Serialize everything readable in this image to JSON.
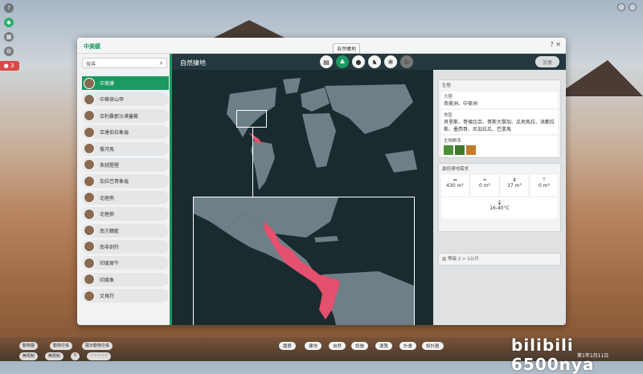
{
  "app": {
    "window_title": "中美貘",
    "tooltip": "自然棲地"
  },
  "left_bar": {
    "help": "?",
    "badge_count": "3"
  },
  "search": {
    "placeholder": "搜尋"
  },
  "animals": [
    {
      "name": "中美貘",
      "selected": true
    },
    {
      "name": "中華穿山甲"
    },
    {
      "name": "亞利桑那沙漠蓋蠍"
    },
    {
      "name": "亞達伯拉象龜"
    },
    {
      "name": "倭河馬"
    },
    {
      "name": "侏狨猩猩"
    },
    {
      "name": "加拉巴哥象龜"
    },
    {
      "name": "北極熊"
    },
    {
      "name": "北極狼"
    },
    {
      "name": "南方鶴鴕"
    },
    {
      "name": "南非劍羚"
    },
    {
      "name": "印度犀牛"
    },
    {
      "name": "印度象"
    },
    {
      "name": "叉角羚"
    }
  ],
  "main": {
    "title": "自然棲地",
    "tabs": [
      {
        "icon": "notebook-icon"
      },
      {
        "icon": "habitat-icon",
        "active": true
      },
      {
        "icon": "food-icon"
      },
      {
        "icon": "social-icon"
      },
      {
        "icon": "paw-icon"
      },
      {
        "icon": "trophy-icon"
      }
    ]
  },
  "right": {
    "header_button": "放養",
    "ecology": {
      "title": "生態",
      "continent_label": "大陸",
      "continent_value": "南美洲、中美洲",
      "region_label": "地區",
      "region_value": "貝里斯、哥倫比亞、哥斯大黎加、瓜地馬拉、洪都拉斯、墨西哥、尼加拉瓜、巴拿馬",
      "biome_label": "生物群系"
    },
    "habitat": {
      "title": "最低棲地需求",
      "stats": [
        "430 m²",
        "0 m²",
        "37 m³",
        "0 m²"
      ],
      "temperature": "16-40°C",
      "footer": "等級 2 > 1公尺"
    }
  },
  "bottom": {
    "left_buttons": [
      "動物園",
      "動物交易",
      "展示動物交易"
    ],
    "status_left": "無限制",
    "status_mid": "無限制",
    "status_count": "0",
    "center_buttons": [
      "園藝",
      "建地",
      "自然",
      "設施",
      "導覽",
      "計畫",
      "設計圖"
    ],
    "date": "第1年1月11日",
    "watermark": "bilibili 6500nya"
  }
}
